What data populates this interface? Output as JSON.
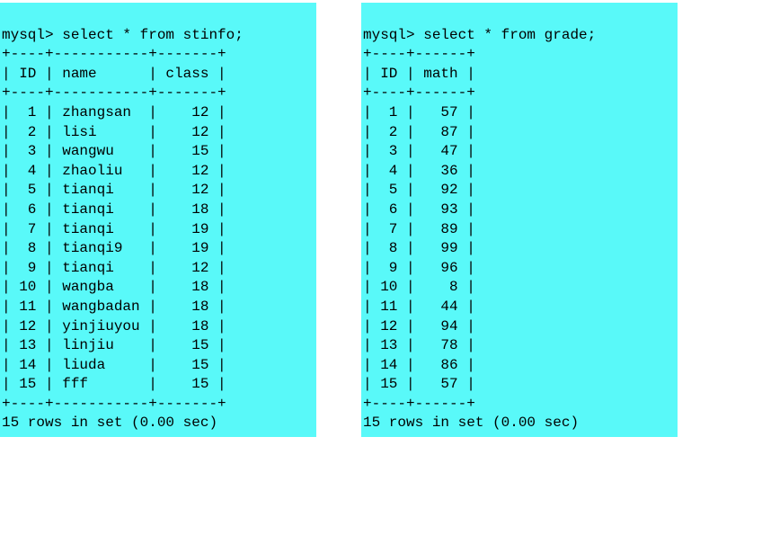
{
  "left": {
    "query": "mysql> select * from stinfo;",
    "border_top": "+----+-----------+-------+",
    "header": "| ID | name      | class |",
    "border_mid": "+----+-----------+-------+",
    "rows": [
      "|  1 | zhangsan  |    12 |",
      "|  2 | lisi      |    12 |",
      "|  3 | wangwu    |    15 |",
      "|  4 | zhaoliu   |    12 |",
      "|  5 | tianqi    |    12 |",
      "|  6 | tianqi    |    18 |",
      "|  7 | tianqi    |    19 |",
      "|  8 | tianqi9   |    19 |",
      "|  9 | tianqi    |    12 |",
      "| 10 | wangba    |    18 |",
      "| 11 | wangbadan |    18 |",
      "| 12 | yinjiuyou |    18 |",
      "| 13 | linjiu    |    15 |",
      "| 14 | liuda     |    15 |",
      "| 15 | fff       |    15 |"
    ],
    "border_bot": "+----+-----------+-------+",
    "footer": "15 rows in set (0.00 sec)"
  },
  "right": {
    "query": "mysql> select * from grade;",
    "border_top": "+----+------+",
    "header": "| ID | math |",
    "border_mid": "+----+------+",
    "rows": [
      "|  1 |   57 |",
      "|  2 |   87 |",
      "|  3 |   47 |",
      "|  4 |   36 |",
      "|  5 |   92 |",
      "|  6 |   93 |",
      "|  7 |   89 |",
      "|  8 |   99 |",
      "|  9 |   96 |",
      "| 10 |    8 |",
      "| 11 |   44 |",
      "| 12 |   94 |",
      "| 13 |   78 |",
      "| 14 |   86 |",
      "| 15 |   57 |"
    ],
    "border_bot": "+----+------+",
    "footer": "15 rows in set (0.00 sec)"
  }
}
